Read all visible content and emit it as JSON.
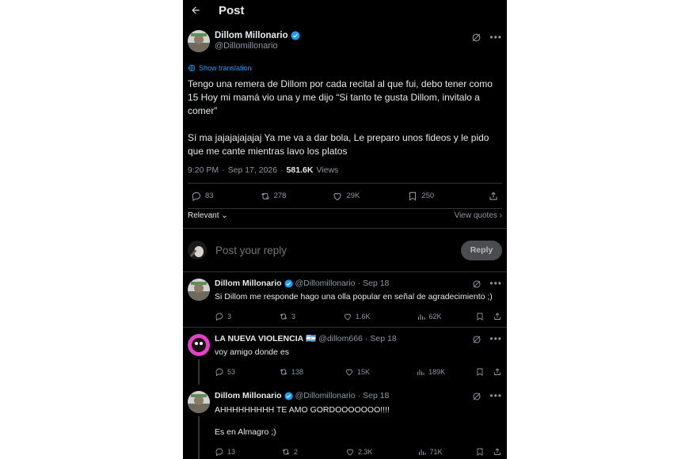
{
  "header": {
    "title": "Post",
    "back_icon": "arrow-left-icon"
  },
  "post": {
    "author_name": "Dillom Millonario",
    "handle": "@Dillomillonario",
    "verified": true,
    "show_translation": "Show translation",
    "text": "Tengo una remera de Dillom por cada recital al que fui, debo tener como 15 Hoy mi mamá vio una y me dijo “Si tanto te gusta Dillom, invitalo a comer”\n\nSí ma jajajajajajaj Ya me va a dar bola, Le preparo unos fideos y le pido que me cante mientras lavo los platos",
    "time": "9:20 PM",
    "sep": "·",
    "date": "Sep 17, 2026",
    "views": "581.6K",
    "views_label": "Views",
    "stats": {
      "replies": "83",
      "reposts": "278",
      "likes": "29K",
      "bookmarks": "250"
    },
    "sort_label": "Relevant",
    "view_quotes": "View quotes"
  },
  "composer": {
    "placeholder": "Post your reply",
    "button": "Reply"
  },
  "replies": [
    {
      "name": "Dillom Millonario",
      "verified": true,
      "handle": "@Dillomillonario",
      "date": "Sep 18",
      "text": "Si Dillom me responde hago una olla popular en señal de agradecimiento ;)",
      "stats": {
        "replies": "3",
        "reposts": "3",
        "likes": "1.6K",
        "views": "62K"
      }
    },
    {
      "name": "LA NUEVA VIOLENCIA",
      "flag": "🇦🇷",
      "verified": false,
      "handle": "@dillom666",
      "date": "Sep 18",
      "text": "voy amigo donde es",
      "stats": {
        "replies": "53",
        "reposts": "138",
        "likes": "15K",
        "views": "189K"
      }
    },
    {
      "name": "Dillom Millonario",
      "verified": true,
      "handle": "@Dillomillonario",
      "date": "Sep 18",
      "text": "AHHHHHHHHH TE AMO GORDOOOOOOO!!!!\n\nEs en Almagro ;)",
      "stats": {
        "replies": "13",
        "reposts": "2",
        "likes": "2.3K",
        "views": "71K"
      }
    }
  ],
  "colors": {
    "background": "#000000",
    "accent": "#1d9bf0",
    "muted": "#8b98a5",
    "text": "#e7e9ea",
    "divider": "#2f3336"
  }
}
